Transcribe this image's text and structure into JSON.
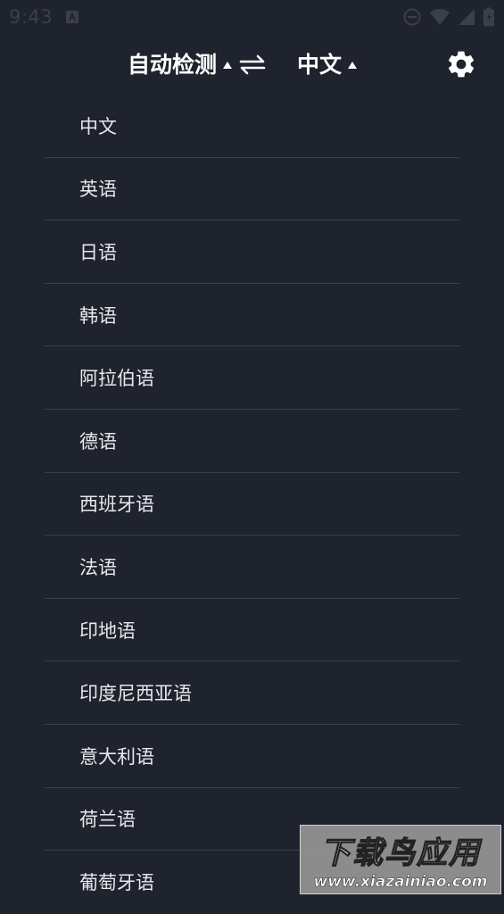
{
  "status_bar": {
    "time": "9:43",
    "icons": [
      "notification-a-icon",
      "do-not-disturb-icon",
      "wifi-icon",
      "signal-icon",
      "battery-icon"
    ]
  },
  "header": {
    "source_language": "自动检测",
    "target_language": "中文",
    "icons": [
      "caret-up-icon",
      "swap-arrows-icon",
      "gear-icon"
    ]
  },
  "languages": [
    "中文",
    "英语",
    "日语",
    "韩语",
    "阿拉伯语",
    "德语",
    "西班牙语",
    "法语",
    "印地语",
    "印度尼西亚语",
    "意大利语",
    "荷兰语",
    "葡萄牙语"
  ],
  "watermark": {
    "title": "下载鸟应用",
    "url": "www.xiazainiao.com"
  },
  "colors": {
    "background": "#1f232d",
    "divider": "#3a3f4a",
    "text": "#e6e8ec",
    "header_text": "#ffffff"
  }
}
